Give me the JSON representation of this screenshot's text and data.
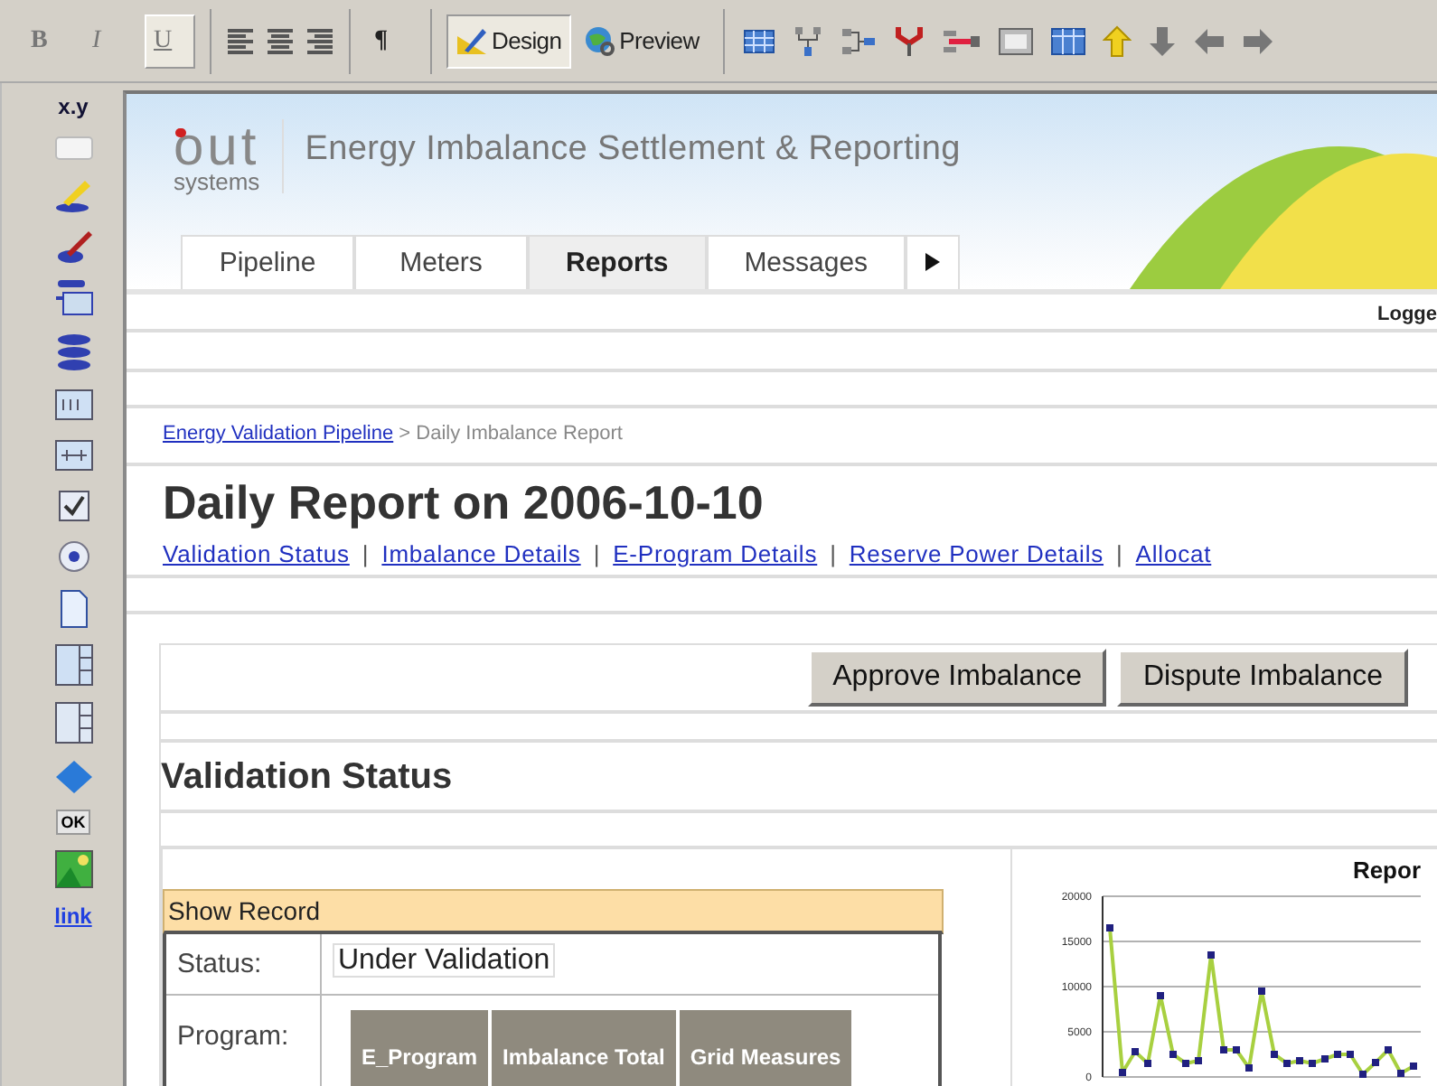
{
  "toolbar": {
    "format_buttons": [
      {
        "label": "B",
        "selected": false
      },
      {
        "label": "I",
        "selected": false
      },
      {
        "label": "U",
        "selected": true
      }
    ],
    "paragraph_button": "¶",
    "view_modes": [
      {
        "label": "Design",
        "selected": true
      },
      {
        "label": "Preview",
        "selected": false
      }
    ]
  },
  "palette": {
    "expression_label": "x.y",
    "button_label": "OK",
    "link_label": "link"
  },
  "app": {
    "logo_mark": "out",
    "logo_sub": "systems",
    "title": "Energy Imbalance Settlement & Reporting"
  },
  "tabs": [
    {
      "label": "Pipeline",
      "selected": false
    },
    {
      "label": "Meters",
      "selected": false
    },
    {
      "label": "Reports",
      "selected": true
    },
    {
      "label": "Messages",
      "selected": false
    }
  ],
  "login_text": "Logge",
  "breadcrumb": {
    "link": "Energy Validation Pipeline",
    "current": "> Daily Imbalance Report"
  },
  "page_title": "Daily Report on 2006-10-10",
  "section_links": {
    "separator": "|",
    "links": [
      "Validation Status",
      "Imbalance Details",
      "E-Program Details",
      "Reserve Power Details",
      "Allocat"
    ]
  },
  "actions": [
    "Approve Imbalance",
    "Dispute Imbalance"
  ],
  "section_title": "Validation Status",
  "record": {
    "title": "Show Record",
    "status_label": "Status:",
    "status_value": "Under Validation",
    "program_label": "Program:",
    "program_buttons": [
      {
        "label": "E_Program",
        "disabled": true
      },
      {
        "label": "Imbalance Total",
        "disabled": true
      },
      {
        "label": "Grid Measures",
        "disabled": true
      }
    ]
  },
  "chart": {
    "chart_data": {
      "type": "line",
      "title": "Repor",
      "ylim": [
        0,
        20000
      ],
      "yticks": [
        0,
        5000,
        10000,
        15000,
        20000
      ],
      "grid": true,
      "series": [
        {
          "color": "#a8d040",
          "values": [
            16500,
            500,
            2800,
            1500,
            9000,
            2500,
            1500,
            1800,
            13500,
            3000,
            3000,
            1000,
            9500,
            2500,
            1500,
            1800,
            1500,
            2000,
            2500,
            2500,
            300,
            1600,
            3000,
            400,
            1200
          ]
        }
      ]
    }
  }
}
